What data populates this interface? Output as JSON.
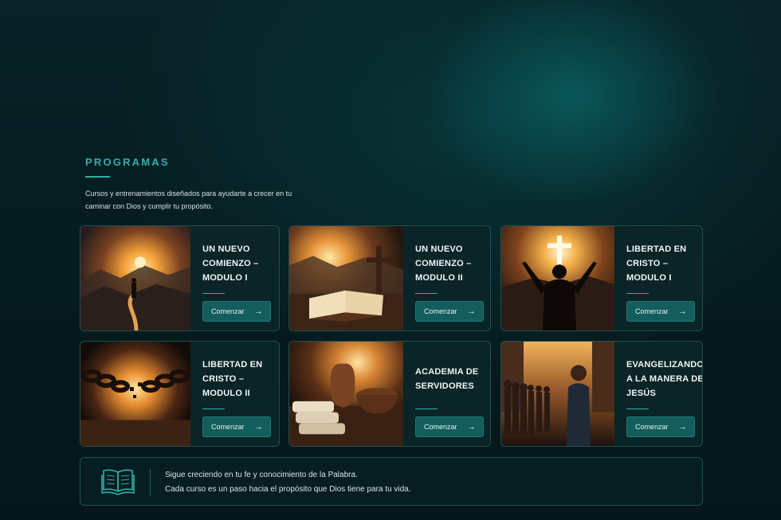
{
  "section": {
    "heading": "PROGRAMAS",
    "subtitle": "Cursos y entrenamientos diseñados para ayudarte a crecer en tu caminar con Dios y cumplir tu propósito."
  },
  "colors": {
    "accent": "#2bb3a6",
    "button": "#135d5c",
    "card": "#0a2427"
  },
  "courses": [
    {
      "title": "UN NUEVO COMIENZO – MODULO I",
      "button": "Comenzar",
      "image_icon": "path-sunrise-image"
    },
    {
      "title": "UN NUEVO COMIENZO – MODULO II",
      "button": "Comenzar",
      "image_icon": "bible-cross-image"
    },
    {
      "title": "LIBERTAD EN CRISTO – MODULO I",
      "button": "Comenzar",
      "image_icon": "raised-hands-cross-image"
    },
    {
      "title": "LIBERTAD EN CRISTO – MODULO II",
      "button": "Comenzar",
      "image_icon": "broken-chains-image"
    },
    {
      "title": "ACADEMIA DE SERVIDORES",
      "button": "Comenzar",
      "image_icon": "towels-basin-image"
    },
    {
      "title": "EVANGELIZANDO A LA MANERA DE JESÚS",
      "button": "Comenzar",
      "image_icon": "street-crowd-image"
    }
  ],
  "footer": {
    "line1": "Sigue creciendo en tu fe y conocimiento de la Palabra.",
    "line2": "Cada curso es un paso hacia el propósito que Dios tiene para tu vida.",
    "icon": "open-book-icon"
  }
}
